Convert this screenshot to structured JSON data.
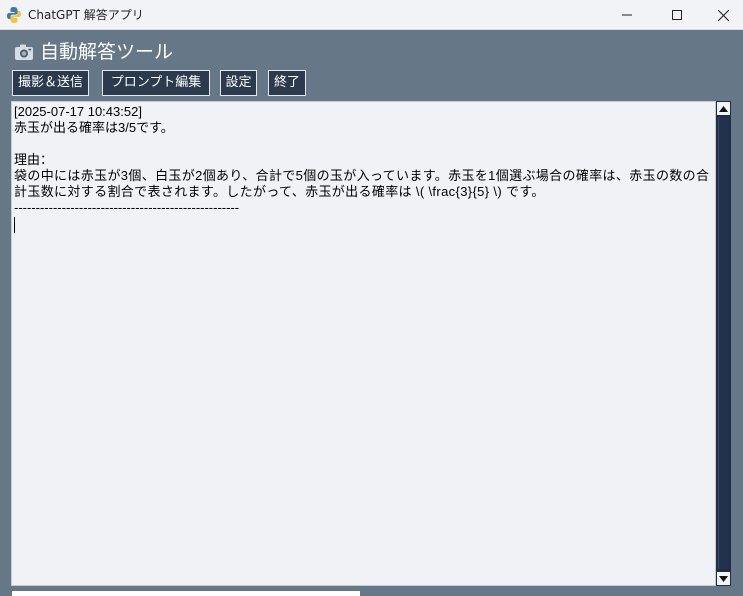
{
  "window": {
    "title": "ChatGPT 解答アプリ"
  },
  "header": {
    "icon": "camera-icon",
    "title": "自動解答ツール"
  },
  "toolbar": {
    "capture_send_label": "撮影＆送信",
    "prompt_edit_label": "プロンプト編集",
    "settings_label": "設定",
    "exit_label": "終了"
  },
  "output": {
    "timestamp": "[2025-07-17 10:43:52]",
    "answer": "赤玉が出る確率は3/5です。",
    "reason_label": "理由：",
    "reason_text": "袋の中には赤玉が3個、白玉が2個あり、合計で5個の玉が入っています。赤玉を1個選ぶ場合の確率は、赤玉の数の合計玉数に対する割合で表されます。したがって、赤玉が出る確率は \\( \\frac{3}{5} \\) です。",
    "separator": "----------------------------------------------------"
  },
  "colors": {
    "background": "#667788",
    "button_bg": "#2b3a4d",
    "textarea_bg": "#f0f2f6",
    "scrollbar": "#1f2d45"
  }
}
